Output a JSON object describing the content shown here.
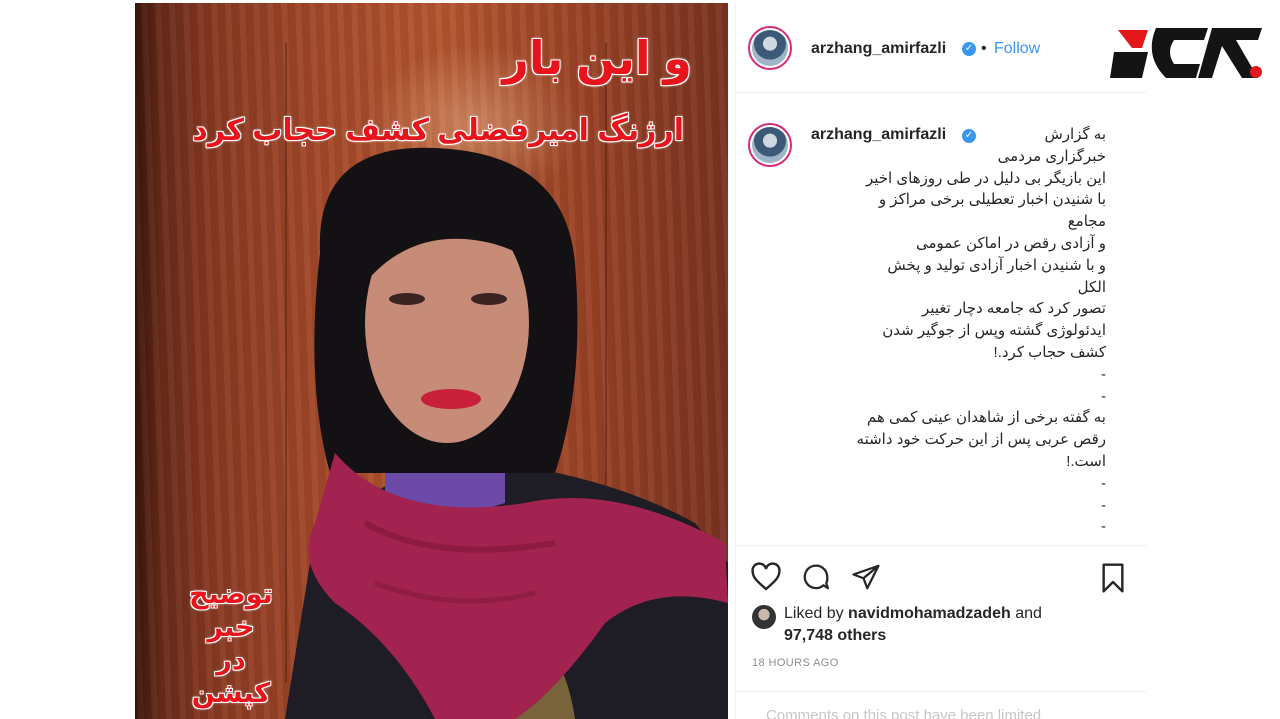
{
  "photo": {
    "headline_line1": "و این بار",
    "headline_line2": "ارژنگ امیرفضلی کشف حجاب کرد",
    "caption_note": [
      "توضیح",
      "خبر",
      "در کپشن"
    ]
  },
  "post": {
    "header": {
      "username": "arzhang_amirfazli",
      "separator": "•",
      "follow_label": "Follow"
    },
    "caption": {
      "username": "arzhang_amirfazli",
      "lines": [
        "به گزارش",
        "خبرگزاری مردمی",
        "این بازیگر بی دلیل در طی روزهای اخیر",
        "با شنیدن اخبار تعطیلی برخی مراکز و",
        "مجامع",
        "و آزادی رقص در اماکن عمومی",
        "و با شنیدن اخبار آزادی تولید و پخش",
        "الکل",
        "تصور کرد که جامعه دچار تغییر",
        "ایدئولوژی گشته وپس از جوگیر شدن",
        "کشف حجاب کرد.!",
        "-",
        "-",
        "به گفته برخی از شاهدان عینی کمی هم",
        "رقص عربی پس از این حرکت خود داشته",
        "است.!",
        "-",
        "-",
        "-"
      ]
    },
    "likes": {
      "prefix": "Liked by",
      "liker": "navidmohamadzadeh",
      "suffix": "and",
      "others": "97,748 others"
    },
    "timestamp": "18 HOURS AGO",
    "comments_notice": "Comments on this post have been limited"
  },
  "icons": {
    "like": "heart-icon",
    "comment": "comment-icon",
    "share": "share-icon",
    "save": "bookmark-icon",
    "verified": "verified-badge-icon"
  },
  "colors": {
    "headline_red": "#e8141c",
    "follow_blue": "#3897f0",
    "verified_blue": "#3897f0",
    "logo_red": "#e3161c"
  }
}
